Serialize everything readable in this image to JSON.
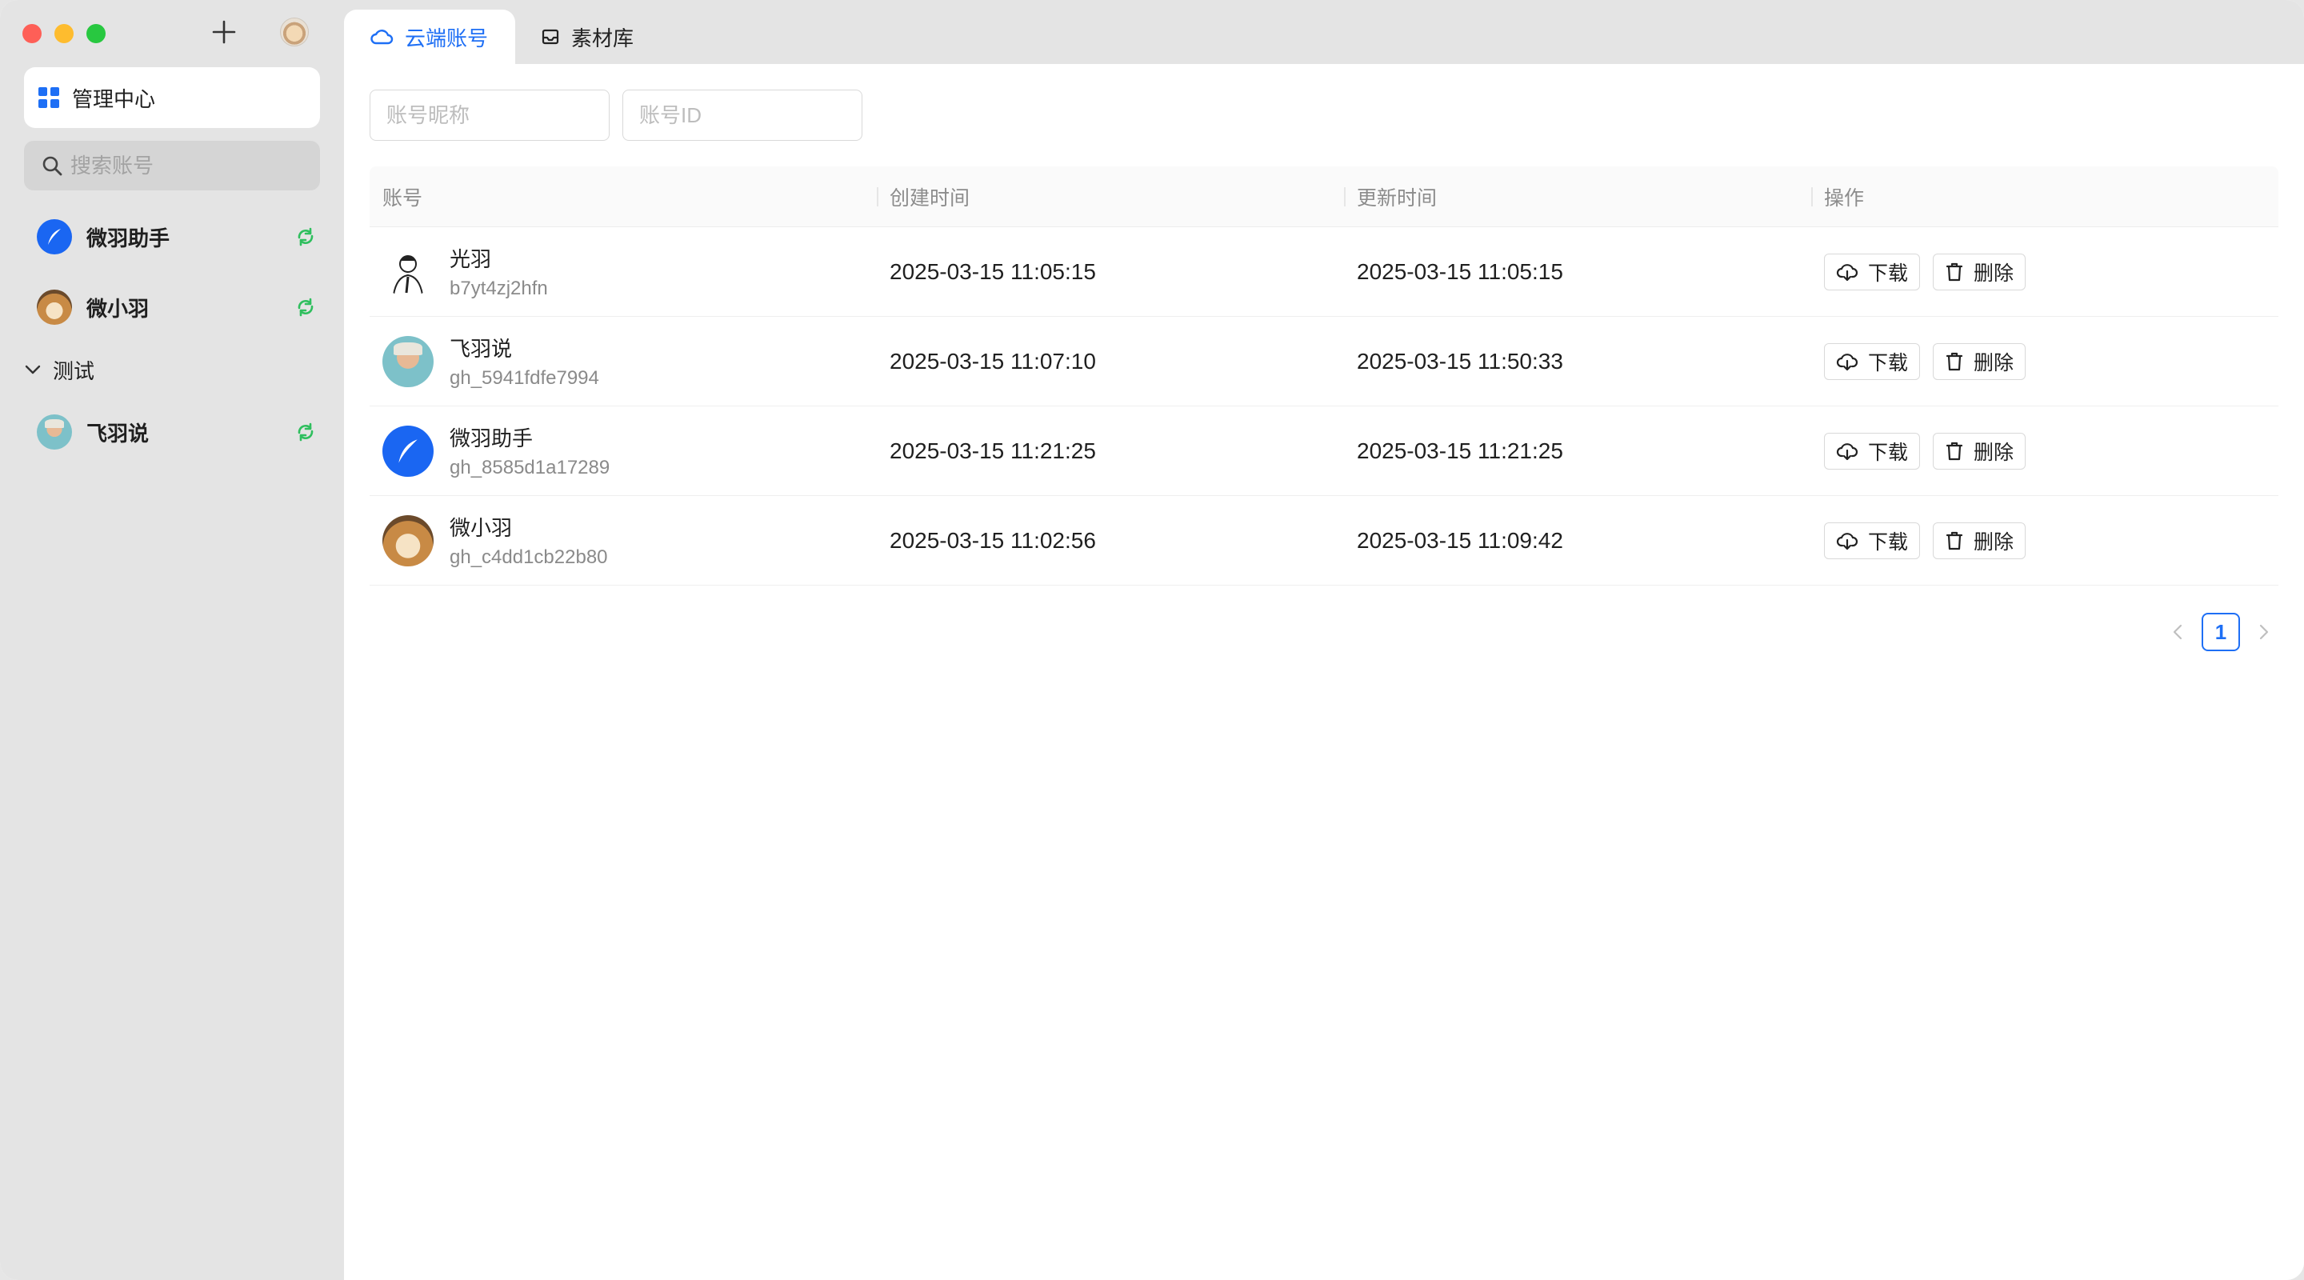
{
  "sidebar": {
    "manage_label": "管理中心",
    "search_placeholder": "搜索账号",
    "accounts": [
      {
        "name": "微羽助手"
      },
      {
        "name": "微小羽"
      }
    ],
    "group": {
      "label": "测试",
      "accounts": [
        {
          "name": "飞羽说"
        }
      ]
    }
  },
  "tabs": [
    {
      "label": "云端账号",
      "icon": "cloud-icon",
      "active": true
    },
    {
      "label": "素材库",
      "icon": "inbox-icon",
      "active": false
    }
  ],
  "filters": {
    "nickname_placeholder": "账号昵称",
    "id_placeholder": "账号ID"
  },
  "table": {
    "columns": [
      "账号",
      "创建时间",
      "更新时间",
      "操作"
    ],
    "download_label": "下载",
    "delete_label": "删除",
    "rows": [
      {
        "name": "光羽",
        "id": "b7yt4zj2hfn",
        "created": "2025-03-15 11:05:15",
        "updated": "2025-03-15 11:05:15"
      },
      {
        "name": "飞羽说",
        "id": "gh_5941fdfe7994",
        "created": "2025-03-15 11:07:10",
        "updated": "2025-03-15 11:50:33"
      },
      {
        "name": "微羽助手",
        "id": "gh_8585d1a17289",
        "created": "2025-03-15 11:21:25",
        "updated": "2025-03-15 11:21:25"
      },
      {
        "name": "微小羽",
        "id": "gh_c4dd1cb22b80",
        "created": "2025-03-15 11:02:56",
        "updated": "2025-03-15 11:09:42"
      }
    ]
  },
  "pagination": {
    "current": "1"
  },
  "colors": {
    "accent": "#1e6ff5",
    "sync": "#2fbf5e",
    "sidebar_bg": "#e4e4e4"
  }
}
